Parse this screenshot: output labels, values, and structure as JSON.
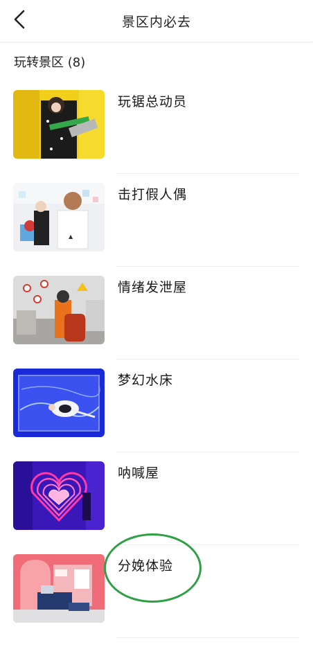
{
  "header": {
    "title": "景区内必去",
    "back_icon": "chevron-left-icon"
  },
  "section": {
    "title": "玩转景区 (8)"
  },
  "items": [
    {
      "title": "玩锯总动员"
    },
    {
      "title": "击打假人偶"
    },
    {
      "title": "情绪发泄屋"
    },
    {
      "title": "梦幻水床"
    },
    {
      "title": "呐喊屋"
    },
    {
      "title": "分娩体验"
    }
  ],
  "colors": {
    "annotation_circle": "#2ea043"
  }
}
